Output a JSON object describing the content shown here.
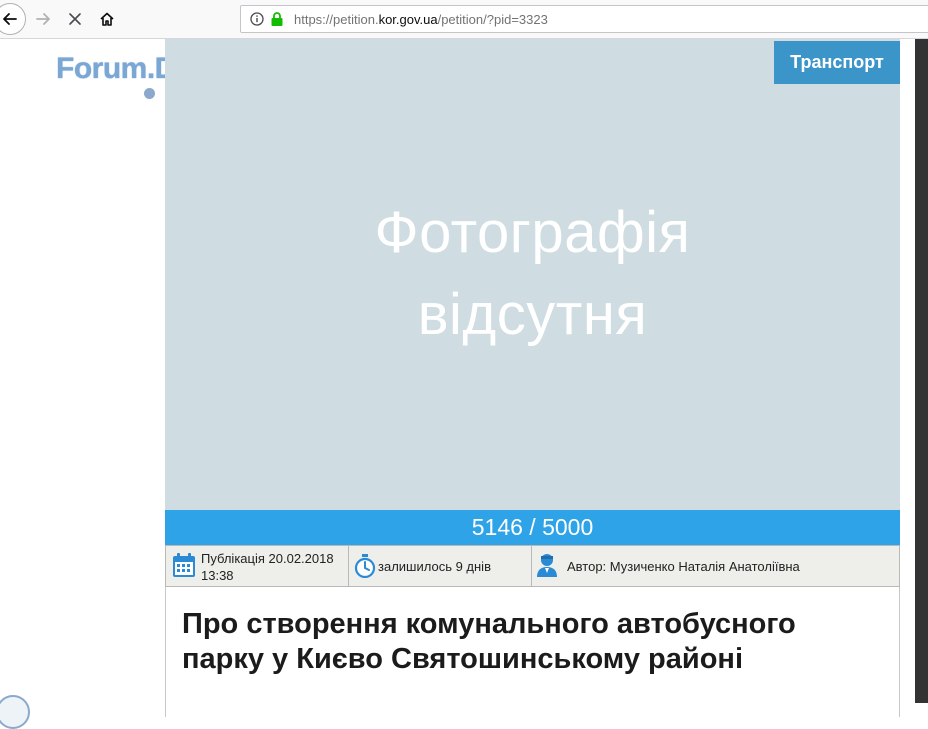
{
  "browser": {
    "url_prefix": "https://petition.",
    "url_domain": "kor.gov.ua",
    "url_suffix": "/petition/?pid=3323"
  },
  "site": {
    "logo_text": "Forum.Domik.ua"
  },
  "petition": {
    "category": "Транспорт",
    "photo_placeholder_line1": "Фотографія",
    "photo_placeholder_line2": "відсутня",
    "votes_text": "5146 / 5000",
    "votes_collected": 5146,
    "votes_required": 5000,
    "published_label": "Публікація 20.02.2018",
    "published_time": "13:38",
    "time_left": "залишилось 9 днів",
    "author": "Автор: Музиченко Наталія Анатоліївна",
    "title": "Про створення комунального автобусного парку у Києво Святошинському районі"
  },
  "colors": {
    "progress": "#2ea3e7",
    "category_badge": "#3b95c8",
    "photo_bg": "#cfdde2",
    "meta_bg": "#eeeeea"
  }
}
